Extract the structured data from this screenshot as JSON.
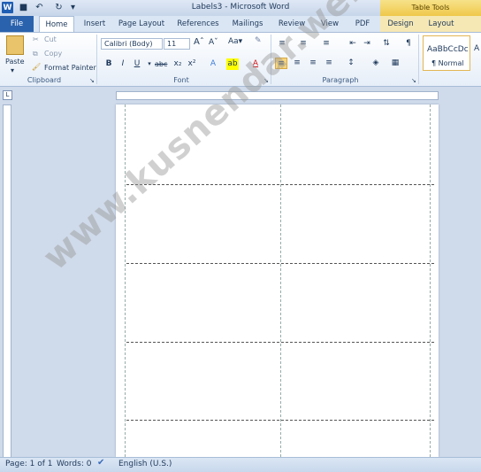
{
  "window": {
    "title": "Labels3  -  Microsoft Word",
    "context_tab_group": "Table Tools"
  },
  "tabs": [
    "File",
    "Home",
    "Insert",
    "Page Layout",
    "References",
    "Mailings",
    "Review",
    "View",
    "PDF",
    "Design",
    "Layout"
  ],
  "clipboard": {
    "paste": "Paste",
    "cut": "Cut",
    "copy": "Copy",
    "format_painter": "Format Painter",
    "group": "Clipboard"
  },
  "font": {
    "name": "Calibri (Body)",
    "size": "11",
    "group": "Font"
  },
  "paragraph": {
    "group": "Paragraph"
  },
  "styles": {
    "preview": "AaBbCcDc",
    "name": "¶ Normal",
    "preview2": "A"
  },
  "status": {
    "page": "Page: 1 of 1",
    "words": "Words: 0",
    "language": "English (U.S.)"
  },
  "watermark": "www.kusnendar.web.id",
  "colors": {
    "accent": "#2a62ad",
    "table_tools": "#efc84a"
  }
}
